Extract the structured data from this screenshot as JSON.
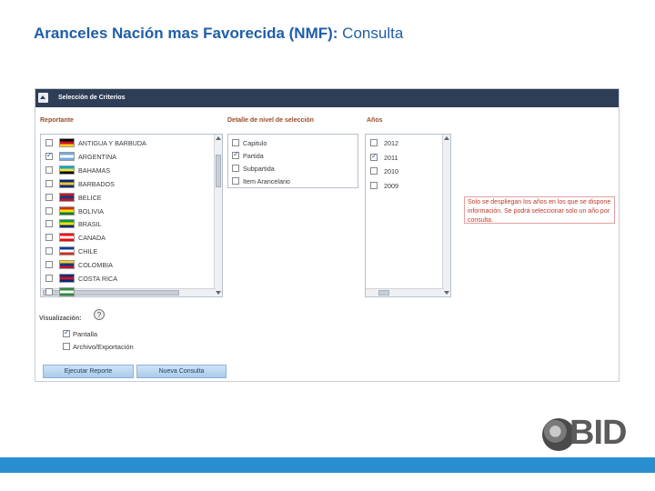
{
  "slide": {
    "title_bold": "Aranceles Nación mas Favorecida (NMF):",
    "title_regular": " Consulta"
  },
  "panel": {
    "title": "Selección de Criterios"
  },
  "reportante": {
    "label": "Reportante",
    "items": [
      {
        "name": "ANTIGUA Y BARBUDA",
        "checked": false,
        "flag": [
          "#000000",
          "#ce1126",
          "#fcd116"
        ]
      },
      {
        "name": "ARGENTINA",
        "checked": true,
        "flag": [
          "#75aadb",
          "#ffffff",
          "#75aadb"
        ]
      },
      {
        "name": "BAHAMAS",
        "checked": false,
        "flag": [
          "#00abc9",
          "#fae042",
          "#000000"
        ]
      },
      {
        "name": "BARBADOS",
        "checked": false,
        "flag": [
          "#00267f",
          "#ffc726",
          "#00267f"
        ]
      },
      {
        "name": "BELICE",
        "checked": false,
        "flag": [
          "#ce1126",
          "#003f87",
          "#ce1126"
        ]
      },
      {
        "name": "BOLIVIA",
        "checked": false,
        "flag": [
          "#d52b1e",
          "#f9e300",
          "#007934"
        ]
      },
      {
        "name": "BRASIL",
        "checked": false,
        "flag": [
          "#009c3b",
          "#ffdf00",
          "#002776"
        ]
      },
      {
        "name": "CANADA",
        "checked": false,
        "flag": [
          "#ff0000",
          "#ffffff",
          "#ff0000"
        ]
      },
      {
        "name": "CHILE",
        "checked": false,
        "flag": [
          "#0039a6",
          "#ffffff",
          "#d52b1e"
        ]
      },
      {
        "name": "COLOMBIA",
        "checked": false,
        "flag": [
          "#fcd116",
          "#003893",
          "#ce1126"
        ]
      },
      {
        "name": "COSTA RICA",
        "checked": false,
        "flag": [
          "#002b7f",
          "#ce1126",
          "#002b7f"
        ]
      },
      {
        "name": "",
        "checked": false,
        "flag": [
          "#2d8a3b",
          "#ffffff",
          "#2d8a3b"
        ]
      }
    ]
  },
  "detalle": {
    "label": "Detalle de nivel de selección",
    "items": [
      {
        "name": "Capitulo",
        "checked": false
      },
      {
        "name": "Partida",
        "checked": true
      },
      {
        "name": "Subpartida",
        "checked": false
      },
      {
        "name": "Item Arancelario",
        "checked": false
      }
    ]
  },
  "anios": {
    "label": "Años",
    "items": [
      {
        "name": "2012",
        "checked": false
      },
      {
        "name": "2011",
        "checked": true
      },
      {
        "name": "2010",
        "checked": false
      },
      {
        "name": "2009",
        "checked": false
      }
    ]
  },
  "note": {
    "text": "Solo se despliegan los años en los que se dispone información. Se podrá seleccionar solo un año por consulta."
  },
  "visualizacion": {
    "label": "Visualización:",
    "options": [
      {
        "name": "Pantalla",
        "checked": true
      },
      {
        "name": "Archivo/Exportación",
        "checked": false
      }
    ]
  },
  "buttons": {
    "execute": "Ejecutar Reporte",
    "new_query": "Nueva Consulta"
  },
  "logo": {
    "text": "BID"
  },
  "colors": {
    "accent": "#2a8fd0",
    "title": "#1f5ea8",
    "header": "#2f3e57",
    "note": "#c0392b"
  },
  "icons": {
    "help": "help-icon",
    "collapse": "collapse-icon"
  }
}
